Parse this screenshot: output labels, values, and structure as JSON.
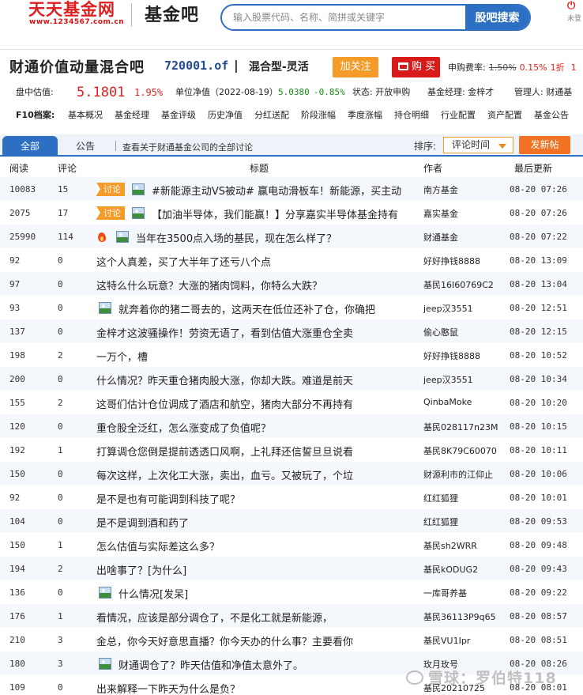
{
  "header": {
    "logo_text": "天天基金网",
    "logo_url": "www.1234567.com.cn",
    "brand": "基金吧",
    "search": {
      "placeholder": "输入股票代码、名称、简拼或关键字",
      "button": "股吧搜索"
    },
    "user_label": "未登"
  },
  "fund": {
    "name": "财通价值动量混合吧",
    "code": "720001.of",
    "separator": "|",
    "type": "混合型-灵活",
    "follow_label": "加关注",
    "buy_label": "购 买",
    "fee_label": "申购费率:",
    "fee_original": "1.50%",
    "fee_current": "0.15%",
    "fee_discount": "1折",
    "fee_tail": "1"
  },
  "estimate": {
    "label": "盘中估值:",
    "value": "5.1801",
    "change": "1.95%",
    "nav_label": "单位净值（2022-08-19）",
    "nav_value": "5.0380",
    "nav_change": "-0.85%",
    "status": "状态: 开放申购",
    "manager": "基金经理: 金梓才",
    "admin": "管理人: 财通基"
  },
  "f10": {
    "label": "F10档案:",
    "links": [
      "基本概况",
      "基金经理",
      "基金评级",
      "历史净值",
      "分红送配",
      "阶段涨幅",
      "季度涨幅",
      "持仓明细",
      "行业配置",
      "资产配置",
      "基金公告"
    ]
  },
  "tabs": {
    "items": [
      "全部",
      "公告"
    ],
    "company_link": "查看关于财通基金公司的全部讨论",
    "sort_label": "排序:",
    "sort_value": "评论时间",
    "post_label": "发新帖"
  },
  "columns": {
    "reads": "阅读",
    "comments": "评论",
    "title": "标题",
    "author": "作者",
    "updated": "最后更新"
  },
  "posts": [
    {
      "reads": "10083",
      "comments": "15",
      "tag": "讨论",
      "icon": "image-icon",
      "title": "#新能源主动VS被动# 赢电动滑板车！新能源，买主动",
      "author": "南方基金",
      "time": "08-20 07:26"
    },
    {
      "reads": "2075",
      "comments": "17",
      "tag": "讨论",
      "icon": "image-icon",
      "title": "【加油半导体，我们能赢！】分享嘉实半导体基金持有",
      "author": "嘉实基金",
      "time": "08-20 07:26"
    },
    {
      "reads": "25990",
      "comments": "114",
      "tag": "",
      "icon": "hot-fire-icon",
      "icon2": "image-icon",
      "title": "当年在3500点入场的基民，现在怎么样了？",
      "author": "财通基金",
      "time": "08-20 07:22"
    },
    {
      "reads": "92",
      "comments": "0",
      "tag": "",
      "icon": "",
      "title": "这个人真差，买了大半年了还亏八个点",
      "author": "好好挣钱8888",
      "time": "08-20 13:09"
    },
    {
      "reads": "97",
      "comments": "0",
      "tag": "",
      "icon": "",
      "title": "这特么什么玩意？大涨的猪肉饲料，你特么大跌？",
      "author": "基民16I60769C2",
      "time": "08-20 13:04"
    },
    {
      "reads": "93",
      "comments": "0",
      "tag": "",
      "icon": "image-icon",
      "title": "就奔着你的猪二哥去的，这两天在低位还补了仓，你确把",
      "author": "jeep汉3551",
      "time": "08-20 12:51"
    },
    {
      "reads": "137",
      "comments": "0",
      "tag": "",
      "icon": "",
      "title": "金梓才这波骚操作！劳资无语了，看到估值大涨重仓全卖",
      "author": "偷心憨鼠",
      "time": "08-20 12:15"
    },
    {
      "reads": "198",
      "comments": "2",
      "tag": "",
      "icon": "",
      "title": "一万个，槽",
      "author": "好好挣钱8888",
      "time": "08-20 10:52"
    },
    {
      "reads": "200",
      "comments": "0",
      "tag": "",
      "icon": "",
      "title": "什么情况？昨天重仓猪肉股大涨，你却大跌。难道是前天",
      "author": "jeep汉3551",
      "time": "08-20 10:34"
    },
    {
      "reads": "155",
      "comments": "2",
      "tag": "",
      "icon": "",
      "title": "这哥们估计仓位调成了酒店和航空，猪肉大部分不再持有",
      "author": "QinbaMoke",
      "time": "08-20 10:20"
    },
    {
      "reads": "120",
      "comments": "0",
      "tag": "",
      "icon": "",
      "title": "重仓股全泛红，怎么涨变成了负值呢？",
      "author": "基民028117n23M",
      "time": "08-20 10:15"
    },
    {
      "reads": "192",
      "comments": "1",
      "tag": "",
      "icon": "",
      "title": "打算调仓您倒是提前透透口风啊，上礼拜还信誓旦旦说看",
      "author": "基民8K79C60070",
      "time": "08-20 10:11"
    },
    {
      "reads": "150",
      "comments": "0",
      "tag": "",
      "icon": "",
      "title": "每次这样，上次化工大涨，卖出，血亏。又被玩了，个垃",
      "author": "财源利市的江仰止",
      "time": "08-20 10:06"
    },
    {
      "reads": "92",
      "comments": "0",
      "tag": "",
      "icon": "",
      "title": "是不是也有可能调到科技了呢？",
      "author": "红红狐狸",
      "time": "08-20 10:01"
    },
    {
      "reads": "104",
      "comments": "0",
      "tag": "",
      "icon": "",
      "title": "是不是调到酒和药了",
      "author": "红红狐狸",
      "time": "08-20 09:53"
    },
    {
      "reads": "150",
      "comments": "1",
      "tag": "",
      "icon": "",
      "title": "怎么估值与实际差这么多？",
      "author": "基民sh2WRR",
      "time": "08-20 09:48"
    },
    {
      "reads": "194",
      "comments": "2",
      "tag": "",
      "icon": "",
      "title": "出啥事了？[为什么]",
      "author": "基民kODUG2",
      "time": "08-20 09:43"
    },
    {
      "reads": "136",
      "comments": "0",
      "tag": "",
      "icon": "image-icon",
      "title": "什么情况[发呆]",
      "author": "一库哥养基",
      "time": "08-20 09:22"
    },
    {
      "reads": "176",
      "comments": "1",
      "tag": "",
      "icon": "",
      "title": "看情况，应该是部分调仓了，不是化工就是新能源，",
      "author": "基民36113P9q65",
      "time": "08-20 08:57"
    },
    {
      "reads": "210",
      "comments": "3",
      "tag": "",
      "icon": "",
      "title": "金总，你今天好意思直播？你今天办的什么事？主要看你",
      "author": "基民VU1Ipr",
      "time": "08-20 08:51"
    },
    {
      "reads": "180",
      "comments": "3",
      "tag": "",
      "icon": "image-icon",
      "title": "财通调仓了？昨天估值和净值太意外了。",
      "author": "玫月玫号",
      "time": "08-20 08:26"
    },
    {
      "reads": "109",
      "comments": "0",
      "tag": "",
      "icon": "",
      "title": "出来解释一下昨天为什么是负？",
      "author": "基民20210725",
      "time": "08-20 08:01"
    }
  ],
  "watermark": "雪球：罗伯特118",
  "colors": {
    "accent": "#2d6fc2",
    "red": "#e02020",
    "orange": "#f49b2a",
    "green": "#1a8a1a"
  }
}
